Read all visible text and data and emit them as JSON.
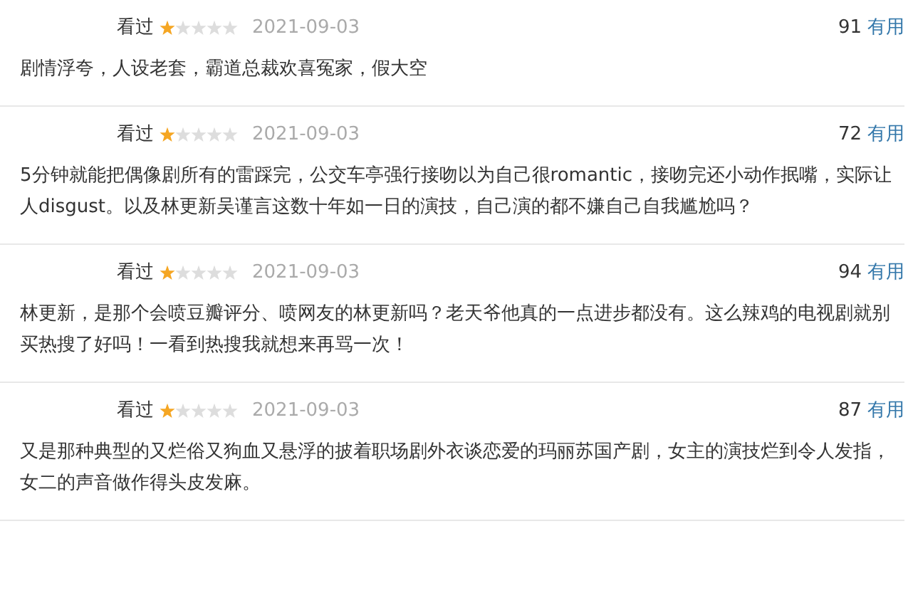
{
  "reviews": [
    {
      "status": "看过",
      "stars": 1,
      "date": "2021-09-03",
      "votes": "91",
      "vote_label": "有用",
      "text": "剧情浮夸，人设老套，霸道总裁欢喜冤家，假大空"
    },
    {
      "status": "看过",
      "stars": 1,
      "date": "2021-09-03",
      "votes": "72",
      "vote_label": "有用",
      "text": "5分钟就能把偶像剧所有的雷踩完，公交车亭强行接吻以为自己很romantic，接吻完还小动作抿嘴，实际让人disgust。以及林更新吴谨言这数十年如一日的演技，自己演的都不嫌自己自我尴尬吗？"
    },
    {
      "status": "看过",
      "stars": 1,
      "date": "2021-09-03",
      "votes": "94",
      "vote_label": "有用",
      "text": "林更新，是那个会喷豆瓣评分、喷网友的林更新吗？老天爷他真的一点进步都没有。这么辣鸡的电视剧就别买热搜了好吗！一看到热搜我就想来再骂一次！"
    },
    {
      "status": "看过",
      "stars": 1,
      "date": "2021-09-03",
      "votes": "87",
      "vote_label": "有用",
      "text": "又是那种典型的又烂俗又狗血又悬浮的披着职场剧外衣谈恋爱的玛丽苏国产剧，女主的演技烂到令人发指，女二的声音做作得头皮发麻。"
    }
  ]
}
